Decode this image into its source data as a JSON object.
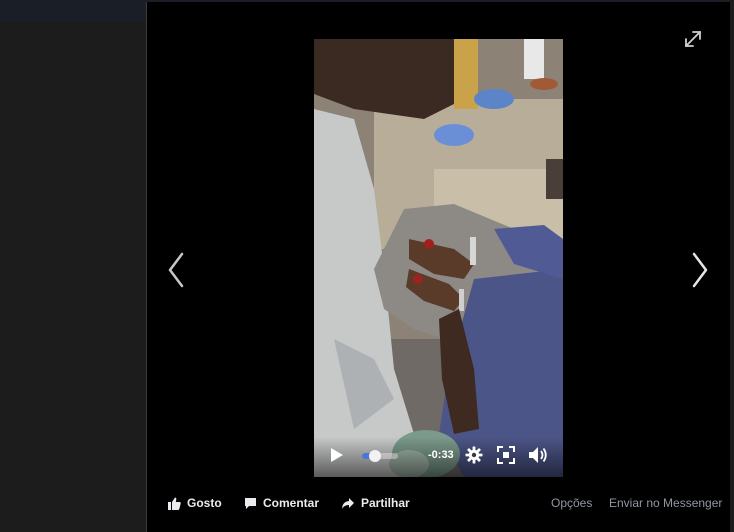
{
  "viewer": {
    "expand_icon": "expand-diagonal-arrows-icon",
    "prev_icon": "chevron-left-icon",
    "next_icon": "chevron-right-icon"
  },
  "video": {
    "player": {
      "time_remaining": "-0:33",
      "progress_fraction": 0.35,
      "play_icon": "play-icon",
      "settings_icon": "gear-icon",
      "fullscreen_icon": "fullscreen-icon",
      "volume_icon": "speaker-icon"
    }
  },
  "actions": {
    "like": "Gosto",
    "comment": "Comentar",
    "share": "Partilhar",
    "options": "Opções",
    "send_messenger": "Enviar no Messenger"
  },
  "colors": {
    "accent": "#4a76d8",
    "background": "#000000",
    "muted_text": "#9097a1"
  }
}
